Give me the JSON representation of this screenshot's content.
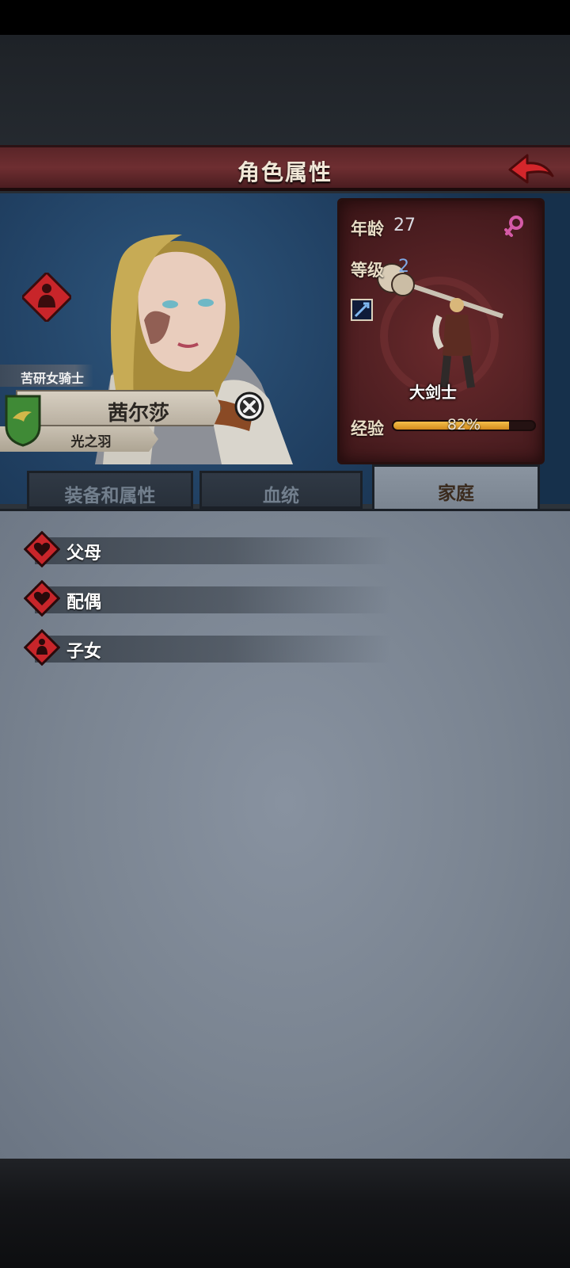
{
  "header": {
    "title": "角色属性"
  },
  "character": {
    "epithet": "苦研女骑士",
    "name": "茜尔莎",
    "subtitle": "光之羽"
  },
  "stats": {
    "age_label": "年龄",
    "age_value": "27",
    "level_label": "等级",
    "level_value": "2",
    "class_name": "大剑士",
    "exp_label": "经验",
    "exp_percent": 82,
    "exp_text": "82%"
  },
  "tabs": [
    {
      "label": "装备和属性",
      "active": false
    },
    {
      "label": "血统",
      "active": false
    },
    {
      "label": "家庭",
      "active": true
    }
  ],
  "family": {
    "parents_label": "父母",
    "spouse_label": "配偶",
    "children_label": "子女"
  },
  "colors": {
    "header_red": "#6e2e31",
    "accent_red": "#c8252a",
    "exp_orange": "#e9a431",
    "level_blue": "#7fa9e6"
  },
  "icons": {
    "back": "red-back-arrow-icon",
    "role": "role-figure-icon",
    "crest": "bird-crest-icon",
    "close": "close-icon",
    "gender": "female-icon",
    "weapon": "sword-icon",
    "parents": "heart-icon",
    "spouse": "heart-icon",
    "children": "child-icon"
  }
}
